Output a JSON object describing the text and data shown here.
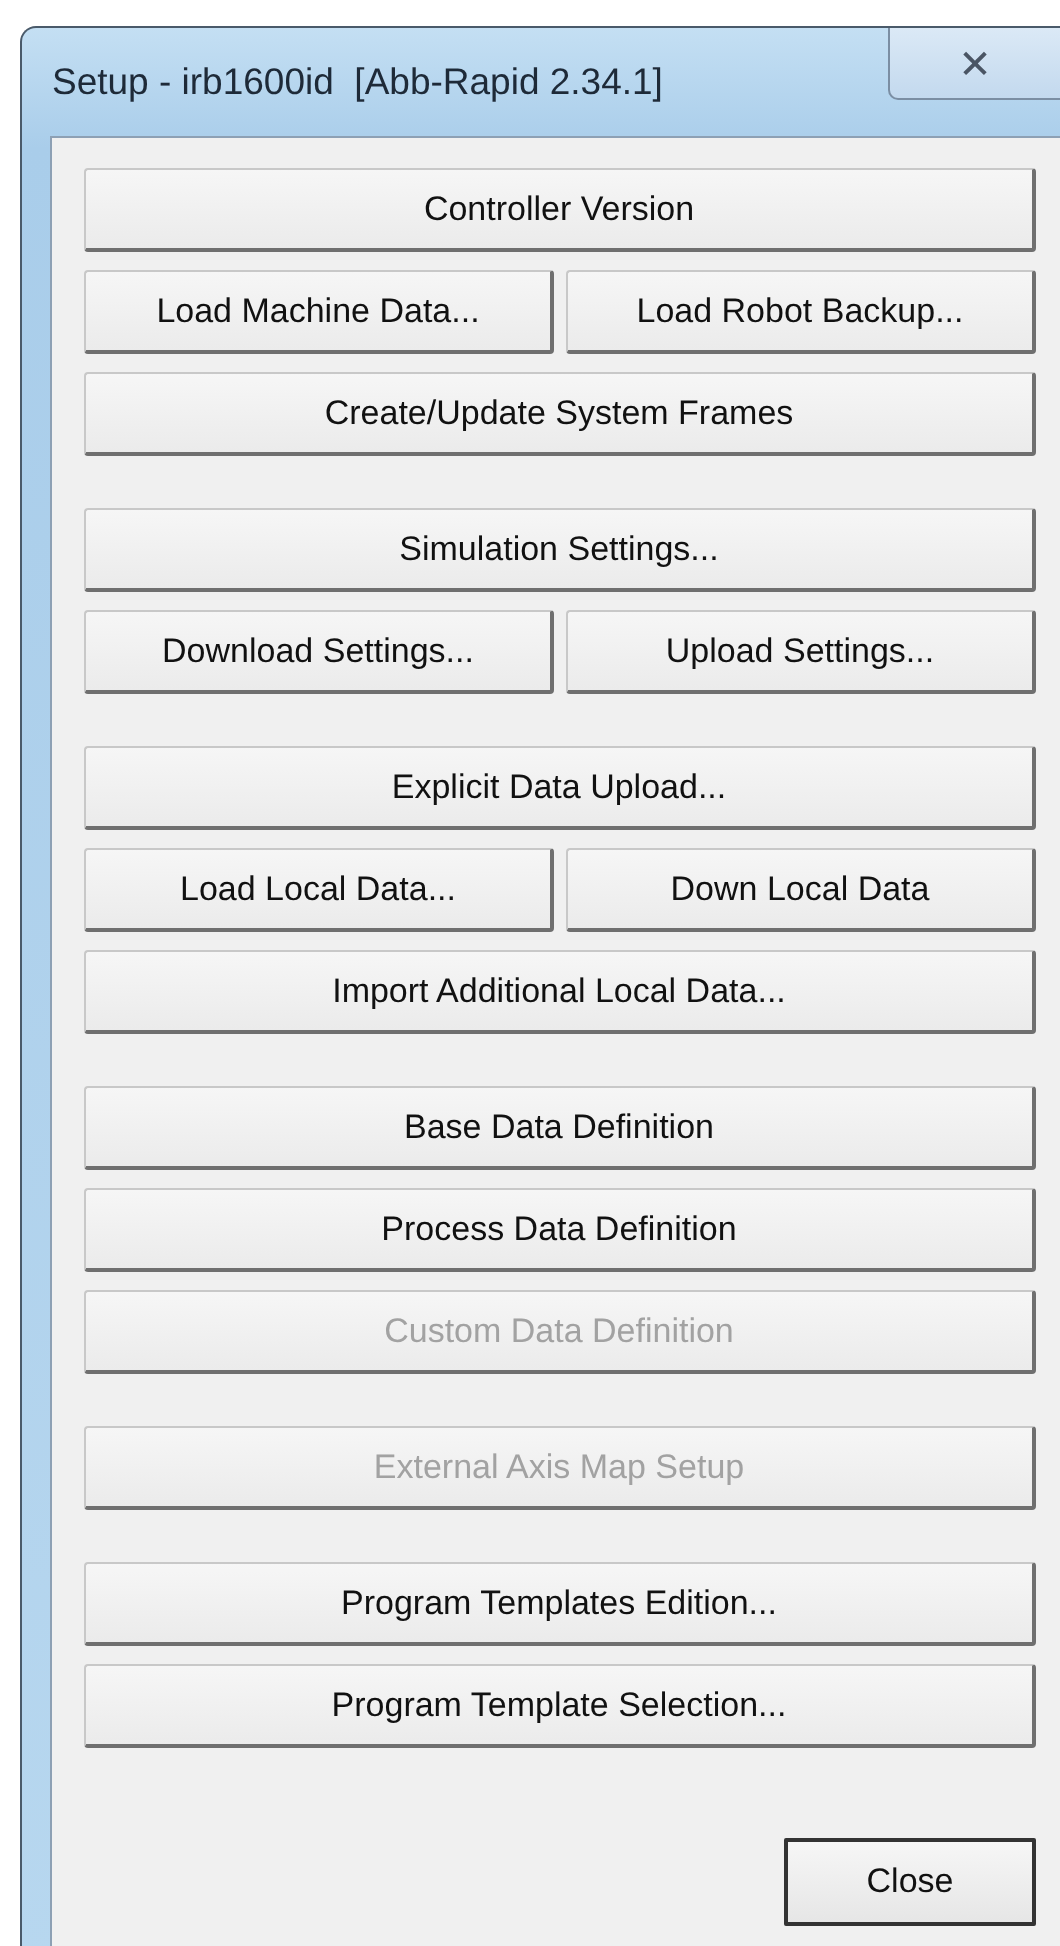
{
  "window": {
    "title": "Setup - irb1600id  [Abb-Rapid 2.34.1]",
    "close_glyph": "✕"
  },
  "groups": [
    [
      [
        {
          "label": "Controller Version",
          "disabled": false
        }
      ],
      [
        {
          "label": "Load Machine Data...",
          "disabled": false
        },
        {
          "label": "Load Robot Backup...",
          "disabled": false
        }
      ],
      [
        {
          "label": "Create/Update System Frames",
          "disabled": false
        }
      ]
    ],
    [
      [
        {
          "label": "Simulation Settings...",
          "disabled": false
        }
      ],
      [
        {
          "label": "Download Settings...",
          "disabled": false
        },
        {
          "label": "Upload Settings...",
          "disabled": false
        }
      ]
    ],
    [
      [
        {
          "label": "Explicit Data Upload...",
          "disabled": false
        }
      ],
      [
        {
          "label": "Load Local Data...",
          "disabled": false
        },
        {
          "label": "Down Local Data",
          "disabled": false
        }
      ],
      [
        {
          "label": "Import Additional Local Data...",
          "disabled": false
        }
      ]
    ],
    [
      [
        {
          "label": "Base Data Definition",
          "disabled": false
        }
      ],
      [
        {
          "label": "Process Data Definition",
          "disabled": false
        }
      ],
      [
        {
          "label": "Custom Data Definition",
          "disabled": true
        }
      ]
    ],
    [
      [
        {
          "label": "External Axis Map Setup",
          "disabled": true
        }
      ]
    ],
    [
      [
        {
          "label": "Program Templates Edition...",
          "disabled": false
        }
      ],
      [
        {
          "label": "Program Template Selection...",
          "disabled": false
        }
      ]
    ]
  ],
  "close_button": {
    "label": "Close"
  }
}
